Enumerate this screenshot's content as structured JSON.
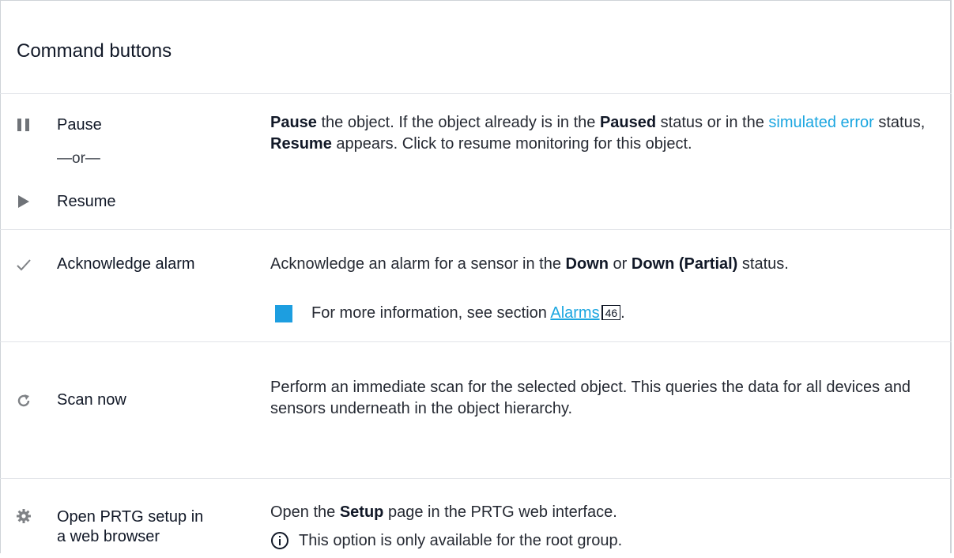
{
  "heading": "Command buttons",
  "rows": [
    {
      "label": "Pause",
      "or": "—or—",
      "label2": "Resume",
      "desc_parts": {
        "p1": "Pause",
        "p2": " the object. If the object already is in the ",
        "p3": "Paused",
        "p4": " status or in the ",
        "p5": "simulated error",
        "p6": " status, ",
        "p7": "Resume",
        "p8": " appears. Click to resume monitoring for this object."
      },
      "icons": [
        "pause-icon",
        "play-icon"
      ]
    },
    {
      "label": "Acknowledge alarm",
      "desc_parts": {
        "p1": "Acknowledge an alarm for a sensor in the ",
        "p2": "Down",
        "p3": " or ",
        "p4": "Down (Partial)",
        "p5": " status."
      },
      "note": {
        "prefix": "For more information, see section ",
        "link": "Alarms",
        "page": "46",
        "suffix": "."
      },
      "icon": "checkmark-icon"
    },
    {
      "label": "Scan now",
      "desc": "Perform an immediate scan for the selected object. This queries the data for all devices and sensors underneath in the object hierarchy.",
      "icon": "refresh-icon"
    },
    {
      "label_line1": "Open PRTG setup in",
      "label_line2": "a web browser",
      "desc_parts": {
        "p1": "Open the ",
        "p2": "Setup",
        "p3": " page in the PRTG web interface."
      },
      "info": "This option is only available for the root group.",
      "icon": "gear-icon"
    }
  ],
  "colors": {
    "link": "#1ba6e0",
    "bluebox": "#1d9ee0",
    "icon": "#7f8286"
  }
}
